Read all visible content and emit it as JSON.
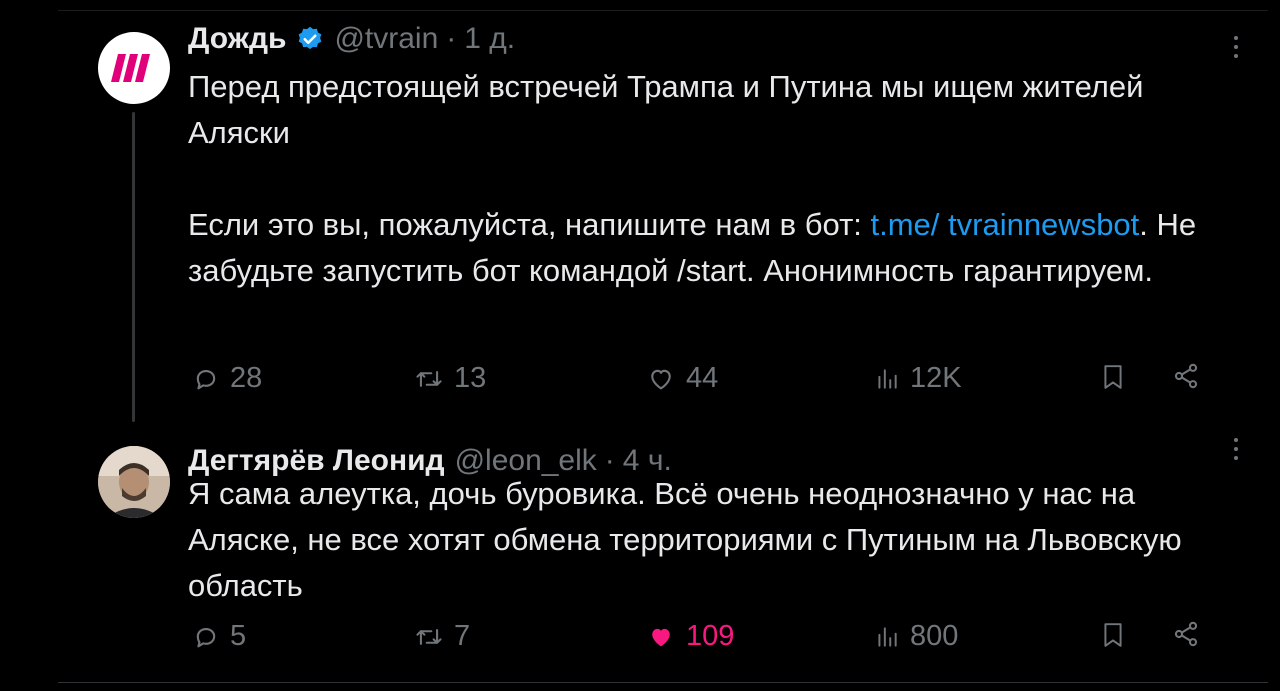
{
  "tweets": [
    {
      "name": "Дождь",
      "verified": true,
      "handle": "@tvrain",
      "time": "1 д.",
      "text": {
        "p1": "Перед предстоящей встречей Трампа и Путина мы ищем жителей Аляски",
        "p2_before": "Если это вы, пожалуйста, напишите нам в бот: ",
        "link": "t.me/ tvrainnewsbot",
        "p2_after": ". Не забудьте запустить бот командой /start. Анонимность гарантируем."
      },
      "stats": {
        "replies": "28",
        "retweets": "13",
        "likes": "44",
        "views": "12K"
      },
      "liked": false
    },
    {
      "name": "Дегтярёв Леонид",
      "verified": false,
      "handle": "@leon_elk",
      "time": "4 ч.",
      "text": {
        "p1": "Я сама алеутка, дочь буровика. Всё очень неоднозначно у нас на Аляске, не все хотят обмена территориями с Путиным на Львовскую область"
      },
      "stats": {
        "replies": "5",
        "retweets": "7",
        "likes": "109",
        "views": "800"
      },
      "liked": true
    }
  ],
  "icons": {
    "verified": "verified-badge-icon",
    "reply": "reply-icon",
    "retweet": "retweet-icon",
    "like": "heart-icon",
    "views": "views-icon",
    "bookmark": "bookmark-icon",
    "share": "share-icon",
    "more": "more-icon"
  },
  "colors": {
    "background": "#000000",
    "text": "#e7e9ea",
    "muted": "#71767b",
    "link": "#1d9bf0",
    "like": "#f91880",
    "rain_logo": "#e1007a"
  }
}
